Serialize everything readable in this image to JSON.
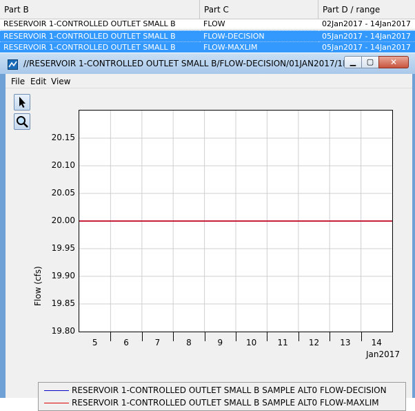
{
  "table": {
    "headers": [
      "Part B",
      "Part C",
      "Part D / range"
    ],
    "rows": [
      {
        "part_b": "RESERVOIR 1-CONTROLLED OUTLET SMALL B",
        "part_c": "FLOW",
        "part_d": "02Jan2017 - 14Jan2017",
        "selected": false
      },
      {
        "part_b": "RESERVOIR 1-CONTROLLED OUTLET SMALL B",
        "part_c": "FLOW-DECISION",
        "part_d": "05Jan2017 - 14Jan2017",
        "selected": true
      },
      {
        "part_b": "RESERVOIR 1-CONTROLLED OUTLET SMALL B",
        "part_c": "FLOW-MAXLIM",
        "part_d": "05Jan2017 - 14Jan2017",
        "selected": true
      }
    ]
  },
  "window": {
    "title": "//RESERVOIR 1-CONTROLLED OUTLET SMALL B/FLOW-DECISION/01JAN2017/1HOU...",
    "buttons": {
      "minimize": "▁",
      "maximize": "▢",
      "close": "✕"
    }
  },
  "menu": [
    "File",
    "Edit",
    "View"
  ],
  "tools": [
    {
      "name": "pointer-tool",
      "icon": "arrow-cursor-icon"
    },
    {
      "name": "zoom-tool",
      "icon": "magnifier-icon"
    }
  ],
  "chart_data": {
    "type": "line",
    "ylabel": "Flow (cfs)",
    "xlabel": "",
    "x_unit_label": "Jan2017",
    "x_ticks": [
      "5",
      "6",
      "7",
      "8",
      "9",
      "10",
      "11",
      "12",
      "13",
      "14"
    ],
    "xlim": [
      4.5,
      14.5
    ],
    "ylim": [
      19.8,
      20.2
    ],
    "y_ticks": [
      "20.15",
      "20.10",
      "20.05",
      "20.00",
      "19.95",
      "19.90",
      "19.85",
      "19.80"
    ],
    "grid": true,
    "series": [
      {
        "name": "RESERVOIR 1-CONTROLLED OUTLET SMALL B SAMPLE ALT0 FLOW-DECISION",
        "color": "#0000cc",
        "x": [
          4.5,
          14.5
        ],
        "y": [
          20.0,
          20.0
        ]
      },
      {
        "name": "RESERVOIR 1-CONTROLLED OUTLET SMALL B SAMPLE ALT0 FLOW-MAXLIM",
        "color": "#dd0000",
        "x": [
          4.5,
          14.5
        ],
        "y": [
          20.0,
          20.0
        ]
      }
    ]
  }
}
